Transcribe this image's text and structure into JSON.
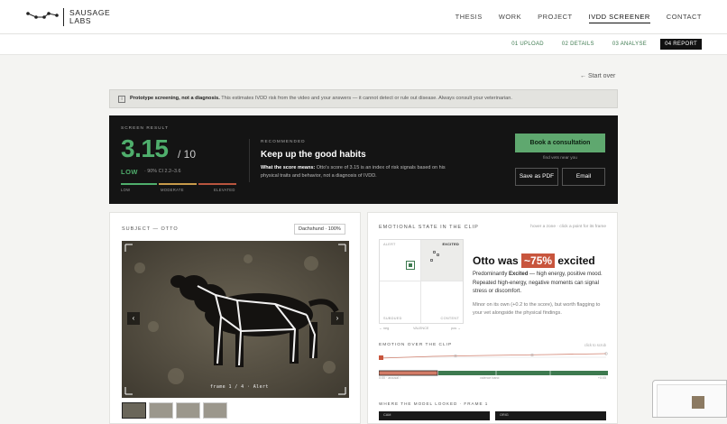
{
  "brand": {
    "line1": "SAUSAGE",
    "line2": "LABS"
  },
  "nav": {
    "items": [
      "THESIS",
      "WORK",
      "PROJECT",
      "IVDD SCREENER",
      "CONTACT"
    ],
    "active": "IVDD SCREENER"
  },
  "steps": [
    {
      "label": "01 UPLOAD",
      "current": false
    },
    {
      "label": "02 DETAILS",
      "current": false
    },
    {
      "label": "03 ANALYSE",
      "current": false
    },
    {
      "label": "04 REPORT",
      "current": true
    }
  ],
  "start_over": "← Start over",
  "notice": {
    "icon": "info-icon",
    "bold": "Prototype screening, not a diagnosis.",
    "text": " This estimates IVDD risk from the video and your answers — it cannot detect or rule out disease. Always consult your veterinarian."
  },
  "result": {
    "label": "SCREEN RESULT",
    "score": "3.15",
    "score_max": "/ 10",
    "score_value": 3.15,
    "level": "LOW",
    "ci": "· 90% CI 2.2–3.6",
    "scale_labels": [
      "LOW",
      "MODERATE",
      "ELEVATED"
    ],
    "colors": {
      "low": "#4fae6c",
      "moderate": "#c79a4a",
      "elevated": "#b8553e"
    }
  },
  "recommendation": {
    "label": "RECOMMENDED",
    "title": "Keep up the good habits",
    "desc_bold": "What the score means:",
    "desc": " Otto's score of 3.15 is an index of risk signals based on his physical traits and behavior, not a diagnosis of IVDD."
  },
  "actions": {
    "consult": "Book a consultation",
    "find_vets": "find vets near you",
    "pdf": "Save as PDF",
    "email": "Email"
  },
  "subject": {
    "label": "SUBJECT — OTTO",
    "breed_badge": "Dachshund · 100%",
    "frame_label": "frame 1 / 4 · Alert",
    "thumb_count": 4
  },
  "emotion": {
    "label": "EMOTIONAL STATE IN THE CLIP",
    "hint": "hover a zone · click a point for its frame",
    "quadrants": [
      "ALERT",
      "EXCITED",
      "SUBDUED",
      "CONTENT"
    ],
    "axis": [
      "← neg",
      "VALENCE",
      "pos →"
    ],
    "headline_pre": "Otto was ",
    "headline_pct": "~75%",
    "headline_post": " excited",
    "desc_pre": "Predominantly ",
    "desc_bold": "Excited",
    "desc_post": " — high energy, positive mood. Repeated high-energy, negative moments can signal stress or discomfort.",
    "note": "Minor on its own (+0.2 to the score), but worth flagging to your vet alongside the physical findings.",
    "accent": "#c8553d"
  },
  "timeline": {
    "label": "EMOTION OVER THE CLIP",
    "hint": "click to scrub",
    "labels": [
      "0:00 · arousal ↑",
      "valence band",
      "+0:05"
    ]
  },
  "looked": {
    "label": "WHERE THE MODEL LOOKED · FRAME 1",
    "cards": [
      "CAM",
      "ORIG"
    ]
  }
}
